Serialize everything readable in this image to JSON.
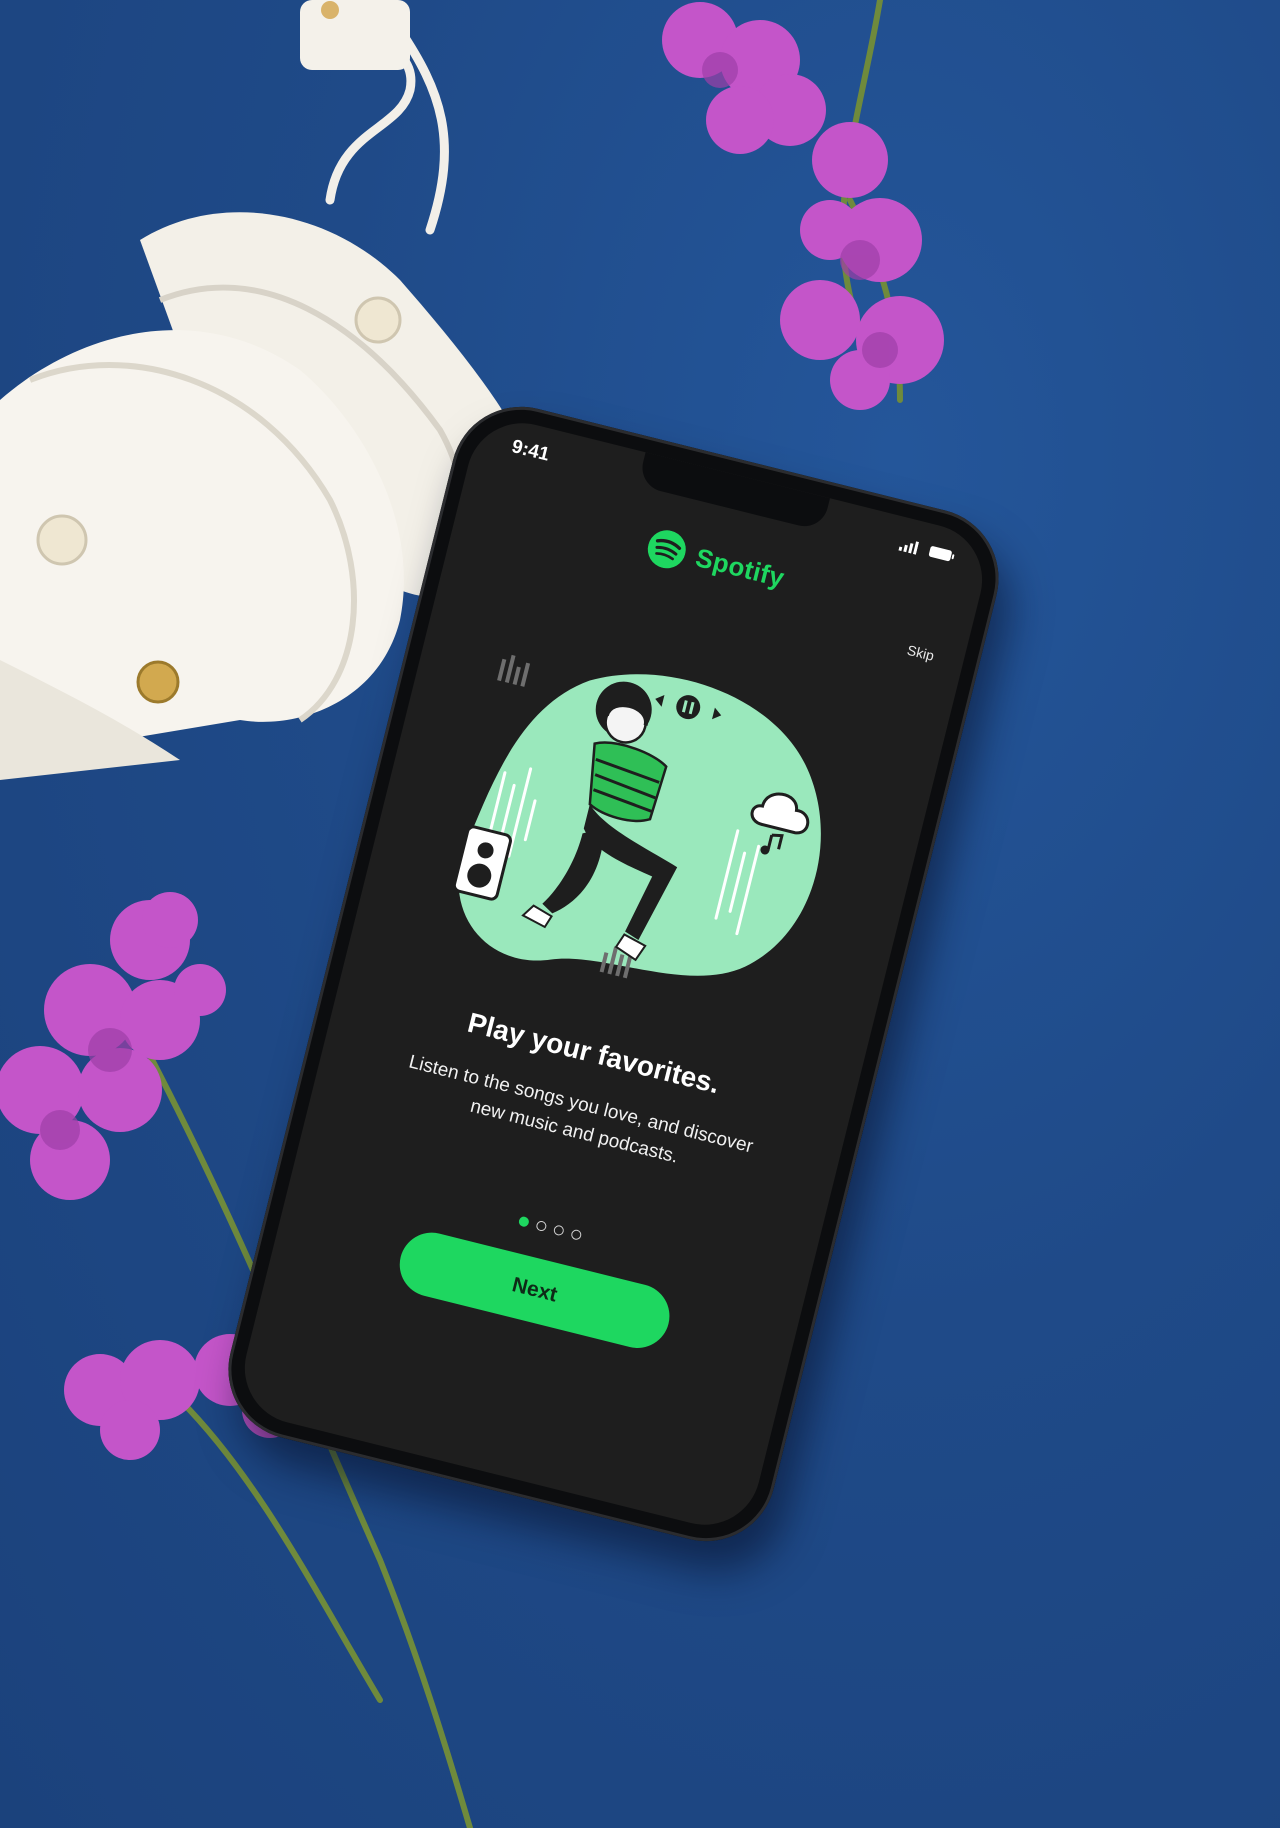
{
  "scene": {
    "background_color": "#1f4a86"
  },
  "status_bar": {
    "time": "9:41",
    "icons": [
      "signal-icon",
      "battery-icon"
    ]
  },
  "brand": {
    "name": "Spotify",
    "icon": "spotify-logo-icon",
    "color": "#1ed760"
  },
  "onboarding": {
    "skip_label": "Skip",
    "headline": "Play your favorites.",
    "description": "Listen to the songs you love, and discover new music and podcasts.",
    "page_count": 4,
    "current_page": 1,
    "next_label": "Next",
    "illustration": {
      "description_icons": [
        "speaker-icon",
        "cloud-music-icon",
        "player-controls-icon",
        "equalizer-icon"
      ],
      "blob_color": "#9ae8bc"
    }
  },
  "theme": {
    "screen_bg": "#1e1e1e",
    "accent": "#1ed760",
    "text": "#ffffff"
  }
}
